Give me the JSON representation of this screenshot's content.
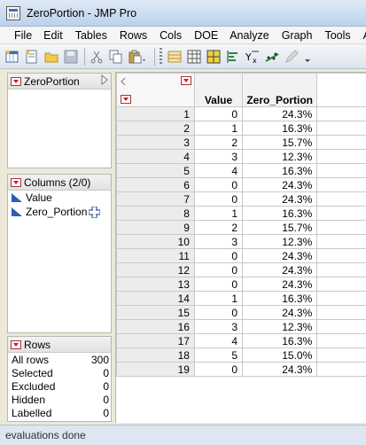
{
  "window": {
    "title": "ZeroPortion - JMP Pro"
  },
  "menu": [
    "File",
    "Edit",
    "Tables",
    "Rows",
    "Cols",
    "DOE",
    "Analyze",
    "Graph",
    "Tools",
    "Ad"
  ],
  "table_panel": {
    "title": "ZeroPortion"
  },
  "columns_panel": {
    "title": "Columns (2/0)",
    "items": [
      {
        "label": "Value",
        "icon": "continuous-icon"
      },
      {
        "label": "Zero_Portion",
        "icon": "continuous-icon",
        "extra_icon": "crosshair-icon"
      }
    ]
  },
  "rows_panel": {
    "title": "Rows",
    "stats": [
      {
        "label": "All rows",
        "value": "300"
      },
      {
        "label": "Selected",
        "value": "0"
      },
      {
        "label": "Excluded",
        "value": "0"
      },
      {
        "label": "Hidden",
        "value": "0"
      },
      {
        "label": "Labelled",
        "value": "0"
      }
    ]
  },
  "grid": {
    "columns": [
      "Value",
      "Zero_Portion"
    ],
    "rows": [
      {
        "n": "1",
        "value": "0",
        "zero_portion": "24.3%"
      },
      {
        "n": "2",
        "value": "1",
        "zero_portion": "16.3%"
      },
      {
        "n": "3",
        "value": "2",
        "zero_portion": "15.7%"
      },
      {
        "n": "4",
        "value": "3",
        "zero_portion": "12.3%"
      },
      {
        "n": "5",
        "value": "4",
        "zero_portion": "16.3%"
      },
      {
        "n": "6",
        "value": "0",
        "zero_portion": "24.3%"
      },
      {
        "n": "7",
        "value": "0",
        "zero_portion": "24.3%"
      },
      {
        "n": "8",
        "value": "1",
        "zero_portion": "16.3%"
      },
      {
        "n": "9",
        "value": "2",
        "zero_portion": "15.7%"
      },
      {
        "n": "10",
        "value": "3",
        "zero_portion": "12.3%"
      },
      {
        "n": "11",
        "value": "0",
        "zero_portion": "24.3%"
      },
      {
        "n": "12",
        "value": "0",
        "zero_portion": "24.3%"
      },
      {
        "n": "13",
        "value": "0",
        "zero_portion": "24.3%"
      },
      {
        "n": "14",
        "value": "1",
        "zero_portion": "16.3%"
      },
      {
        "n": "15",
        "value": "0",
        "zero_portion": "24.3%"
      },
      {
        "n": "16",
        "value": "3",
        "zero_portion": "12.3%"
      },
      {
        "n": "17",
        "value": "4",
        "zero_portion": "16.3%"
      },
      {
        "n": "18",
        "value": "5",
        "zero_portion": "15.0%"
      },
      {
        "n": "19",
        "value": "0",
        "zero_portion": "24.3%"
      }
    ]
  },
  "status": {
    "text": "evaluations done"
  },
  "colors": {
    "accent_red": "#d0161b",
    "continuous_blue": "#2d5eb7",
    "status_bg": "#dde6f1"
  }
}
